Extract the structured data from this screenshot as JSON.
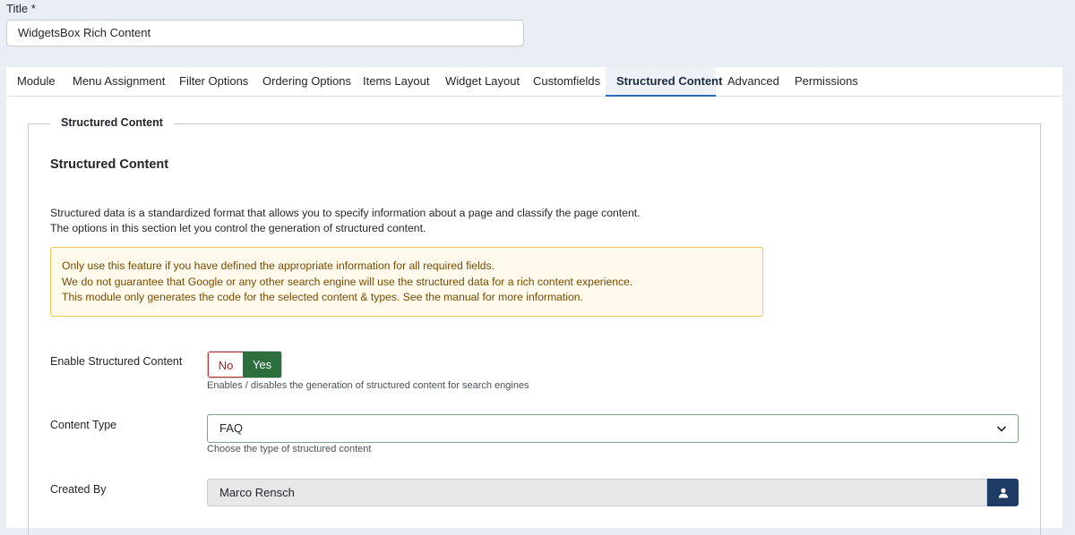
{
  "title_field": {
    "label": "Title *",
    "value": "WidgetsBox Rich Content"
  },
  "tabs": [
    {
      "label": "Module"
    },
    {
      "label": "Menu Assignment"
    },
    {
      "label": "Filter Options"
    },
    {
      "label": "Ordering Options"
    },
    {
      "label": "Items Layout"
    },
    {
      "label": "Widget Layout"
    },
    {
      "label": "Customfields"
    },
    {
      "label": "Structured Content",
      "active": true
    },
    {
      "label": "Advanced"
    },
    {
      "label": "Permissions"
    }
  ],
  "fieldset": {
    "legend": "Structured Content",
    "heading": "Structured Content",
    "description_lines": [
      "Structured data is a standardized format that allows you to specify information about a page and classify the page content.",
      "The options in this section let you control the generation of structured content."
    ],
    "alert_lines": [
      "Only use this feature if you have defined the appropriate information for all required fields.",
      "We do not guarantee that Google or any other search engine will use the structured data for a rich content experience.",
      "This module only generates the code for the selected content & types. See the manual for more information."
    ]
  },
  "fields": {
    "enable": {
      "label": "Enable Structured Content",
      "no_label": "No",
      "yes_label": "Yes",
      "selected": "Yes",
      "help": "Enables / disables the generation of structured content for search engines"
    },
    "content_type": {
      "label": "Content Type",
      "value": "FAQ",
      "help": "Choose the type of structured content"
    },
    "created_by": {
      "label": "Created By",
      "value": "Marco Rensch",
      "button_icon": "user-icon"
    }
  },
  "colors": {
    "page_bg": "#e9eef5",
    "accent": "#2a69b8",
    "yes_green": "#2c6e3e",
    "no_red": "#c32e2e",
    "alert_bg": "#fffaeb",
    "alert_text": "#7a4a00",
    "user_button": "#1f3c66"
  }
}
